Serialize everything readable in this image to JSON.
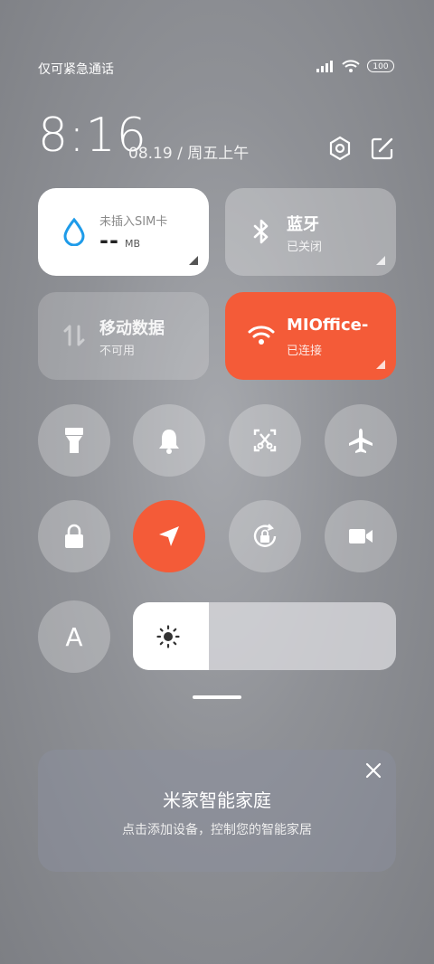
{
  "status": {
    "carrier": "仅可紧急通话",
    "battery": "100",
    "icons": [
      "signal-icon",
      "wifi-icon",
      "battery-icon"
    ]
  },
  "header": {
    "time": "8:16",
    "date": "08.19 / 周五上午"
  },
  "tiles": {
    "data_usage": {
      "label": "未插入SIM卡",
      "value": "--",
      "unit": "MB"
    },
    "bluetooth": {
      "title": "蓝牙",
      "status": "已关闭"
    },
    "mobile_data": {
      "title": "移动数据",
      "status": "不可用"
    },
    "wifi": {
      "title": "MIOffice-",
      "status": "已连接"
    }
  },
  "toggles": [
    {
      "name": "flashlight",
      "active": false
    },
    {
      "name": "mute",
      "active": false
    },
    {
      "name": "screenshot",
      "active": false
    },
    {
      "name": "airplane-mode",
      "active": false
    },
    {
      "name": "lock-screen",
      "active": false
    },
    {
      "name": "location",
      "active": true
    },
    {
      "name": "rotation-lock",
      "active": false
    },
    {
      "name": "screen-record",
      "active": false
    },
    {
      "name": "auto-brightness",
      "label": "A",
      "active": false
    }
  ],
  "brightness": {
    "level": 0.29
  },
  "mi_home": {
    "title": "米家智能家庭",
    "subtitle": "点击添加设备，控制您的智能家居"
  },
  "colors": {
    "accent": "#f45b38",
    "tile_active": "#ffffff"
  }
}
